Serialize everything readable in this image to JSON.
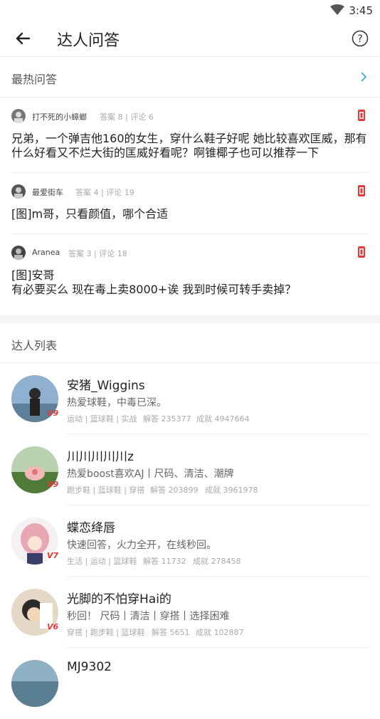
{
  "status": {
    "time": "3:45"
  },
  "header": {
    "title": "达人问答"
  },
  "hot": {
    "label": "最热问答"
  },
  "questions": [
    {
      "user": "打不死的小蟑螂",
      "stats": "答案 8 | 评论 6",
      "text": "兄弟，一个弹吉他160的女生，穿什么鞋子好呢 她比较喜欢匡威，那有什么好看又不烂大街的匡威好看呢？啊锥椰子也可以推荐一下"
    },
    {
      "user": "最爱街车",
      "stats": "答案 4 | 评论 19",
      "text": "[图]m哥，只看颜值，哪个合适"
    },
    {
      "user": "Aranea",
      "stats": "答案 3 | 评论 18",
      "text": "[图]安哥\n 有必要买么  现在毒上卖8000+诶  我到时候可转手卖掉？"
    }
  ],
  "experts_header": {
    "label": "达人列表"
  },
  "experts": [
    {
      "name": "安猪_Wiggins",
      "desc": "热爱球鞋，中毒已深。",
      "tags": "运动 | 篮球鞋 | 实战",
      "answers": "解答 235377",
      "achieve": "成就 4947664",
      "level": "9",
      "ava_color": "#6a8db0"
    },
    {
      "name": "川川川川川z",
      "desc": "热爱boost喜欢AJ丨尺码、清洁、潮牌",
      "tags": "跑步鞋 | 篮球鞋 | 穿搭",
      "answers": "解答 203899",
      "achieve": "成就 3961978",
      "level": "9",
      "ava_color": "#4e7a3a"
    },
    {
      "name": "蝶恋绛唇",
      "desc": "快速回答，火力全开，在线秒回。",
      "tags": "生活 | 运动 | 篮球鞋",
      "answers": "解答 11732",
      "achieve": "成就 278458",
      "level": "7",
      "ava_color": "#e9a7b3"
    },
    {
      "name": "光脚的不怕穿Hai的",
      "desc": "秒回！ 尺码丨清洁丨穿搭丨选择困难",
      "tags": "穿搭 | 跑步鞋 | 篮球鞋",
      "answers": "解答 5651",
      "achieve": "成就 102887",
      "level": "6",
      "ava_color": "#c9a27a"
    },
    {
      "name": "MJ9302",
      "desc": "",
      "tags": "",
      "answers": "",
      "achieve": "",
      "level": "",
      "ava_color": "#5a7f94"
    }
  ]
}
